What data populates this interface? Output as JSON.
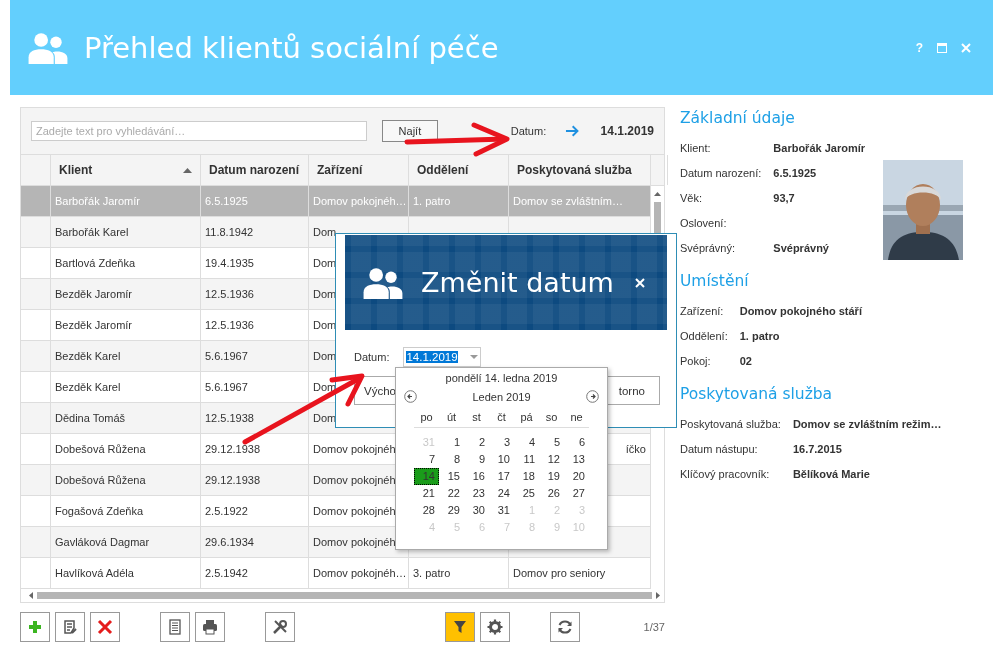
{
  "window": {
    "title": "Přehled klientů sociální péče",
    "help": "?"
  },
  "search": {
    "placeholder": "Zadejte text pro vyhledávání…",
    "button": "Najít",
    "date_label": "Datum:",
    "date_value": "14.1.2019"
  },
  "table": {
    "columns": [
      {
        "label": "Klient",
        "sorted_ascending": true
      },
      {
        "label": "Datum narození"
      },
      {
        "label": "Zařízení"
      },
      {
        "label": "Oddělení"
      },
      {
        "label": "Poskytovaná služba"
      }
    ],
    "rows": [
      {
        "client": "Barbořák Jaromír",
        "birth_date": "6.5.1925",
        "facility": "Domov pokojnéh…",
        "department": "1. patro",
        "service": "Domov se zvláštním…",
        "selected": true
      },
      {
        "client": "Barbořák Karel",
        "birth_date": "11.8.1942",
        "facility": "Dom",
        "selected": false
      },
      {
        "client": "Bartlová Zdeňka",
        "birth_date": "19.4.1935",
        "facility": "Dom",
        "selected": false
      },
      {
        "client": "Bezděk Jaromír",
        "birth_date": "12.5.1936",
        "facility": "Dom",
        "selected": false
      },
      {
        "client": "Bezděk Jaromír",
        "birth_date": "12.5.1936",
        "facility": "Dom",
        "selected": false
      },
      {
        "client": "Bezděk Karel",
        "birth_date": "5.6.1967",
        "facility": "Dom",
        "selected": false
      },
      {
        "client": "Bezděk Karel",
        "birth_date": "5.6.1967",
        "facility": "Dom",
        "selected": false
      },
      {
        "client": "Dědina Tomáš",
        "birth_date": "12.5.1938",
        "facility": "Dom",
        "selected": false
      },
      {
        "client": "Dobešová Růžena",
        "birth_date": "29.12.1938",
        "facility": "Domov pokojnéh",
        "service": "íčko",
        "service_cut_left": true,
        "selected": false
      },
      {
        "client": "Dobešová Růžena",
        "birth_date": "29.12.1938",
        "facility": "Domov pokojnéh",
        "selected": false
      },
      {
        "client": "Fogašová Zdeňka",
        "birth_date": "2.5.1922",
        "facility": "Domov pokojnéh",
        "selected": false
      },
      {
        "client": "Gavláková Dagmar",
        "birth_date": "29.6.1934",
        "facility": "Domov pokojnéh",
        "selected": false
      },
      {
        "client": "Havlíková Adéla",
        "birth_date": "2.5.1942",
        "facility": "Domov pokojnéh…",
        "department": "3. patro",
        "service": "Domov pro seniory",
        "selected": false
      }
    ]
  },
  "toolbar": {
    "left": [
      [
        {
          "kind": "add",
          "on": false
        },
        {
          "kind": "edit",
          "on": false
        },
        {
          "kind": "delete",
          "on": false
        }
      ],
      [
        {
          "kind": "document",
          "on": false
        },
        {
          "kind": "print",
          "on": false
        }
      ],
      [
        {
          "kind": "tools",
          "on": false
        }
      ]
    ],
    "right": [
      [
        {
          "kind": "filter",
          "on": true
        },
        {
          "kind": "settings",
          "on": false
        }
      ],
      [
        {
          "kind": "refresh",
          "on": false
        }
      ]
    ],
    "counter": "1/37"
  },
  "detail": {
    "sections": [
      {
        "title": "Základní údaje",
        "photo": {
          "kind": "picture"
        },
        "fields": [
          {
            "label": "Klient:",
            "value": "Barbořák Jaromír"
          },
          {
            "label": "Datum narození:",
            "value": "6.5.1925"
          },
          {
            "label": "Věk:",
            "value": "93,7"
          },
          {
            "label": "Oslovení:"
          },
          {
            "label": "Svéprávný:",
            "value": "Svéprávný"
          }
        ]
      },
      {
        "title": "Umístění",
        "fields": [
          {
            "label": "Zařízení:",
            "value": "Domov pokojného stáří"
          },
          {
            "label": "Oddělení:",
            "value": "1. patro"
          },
          {
            "label": "Pokoj:",
            "value": "02"
          }
        ]
      },
      {
        "title": "Poskytovaná služba",
        "fields": [
          {
            "label": "Poskytovaná služba:",
            "value": "Domov se zvláštním režim…"
          },
          {
            "label": "Datum nástupu:",
            "value": "16.7.2015"
          },
          {
            "label": "Klíčový pracovník:",
            "value": "Bělíková Marie"
          }
        ]
      }
    ]
  },
  "dialog": {
    "title": "Změnit datum",
    "date_label": "Datum:",
    "date_value": "14.1.2019",
    "value_selected": true,
    "buttons": [
      "Výcho",
      "torno"
    ]
  },
  "calendar": {
    "heading": "pondělí 14. ledna 2019",
    "month": "Leden 2019",
    "weekdays": [
      "po",
      "út",
      "st",
      "čt",
      "pá",
      "so",
      "ne"
    ],
    "weeks": [
      [
        {
          "day": "31",
          "other_month": true,
          "selected": false
        },
        {
          "day": "1",
          "other_month": false,
          "selected": false
        },
        {
          "day": "2",
          "other_month": false,
          "selected": false
        },
        {
          "day": "3",
          "other_month": false,
          "selected": false
        },
        {
          "day": "4",
          "other_month": false,
          "selected": false
        },
        {
          "day": "5",
          "other_month": false,
          "selected": false
        },
        {
          "day": "6",
          "other_month": false,
          "selected": false
        }
      ],
      [
        {
          "day": "7",
          "other_month": false,
          "selected": false
        },
        {
          "day": "8",
          "other_month": false,
          "selected": false
        },
        {
          "day": "9",
          "other_month": false,
          "selected": false
        },
        {
          "day": "10",
          "other_month": false,
          "selected": false
        },
        {
          "day": "11",
          "other_month": false,
          "selected": false
        },
        {
          "day": "12",
          "other_month": false,
          "selected": false
        },
        {
          "day": "13",
          "other_month": false,
          "selected": false
        }
      ],
      [
        {
          "day": "14",
          "other_month": false,
          "selected": true
        },
        {
          "day": "15",
          "other_month": false,
          "selected": false
        },
        {
          "day": "16",
          "other_month": false,
          "selected": false
        },
        {
          "day": "17",
          "other_month": false,
          "selected": false
        },
        {
          "day": "18",
          "other_month": false,
          "selected": false
        },
        {
          "day": "19",
          "other_month": false,
          "selected": false
        },
        {
          "day": "20",
          "other_month": false,
          "selected": false
        }
      ],
      [
        {
          "day": "21",
          "other_month": false,
          "selected": false
        },
        {
          "day": "22",
          "other_month": false,
          "selected": false
        },
        {
          "day": "23",
          "other_month": false,
          "selected": false
        },
        {
          "day": "24",
          "other_month": false,
          "selected": false
        },
        {
          "day": "25",
          "other_month": false,
          "selected": false
        },
        {
          "day": "26",
          "other_month": false,
          "selected": false
        },
        {
          "day": "27",
          "other_month": false,
          "selected": false
        }
      ],
      [
        {
          "day": "28",
          "other_month": false,
          "selected": false
        },
        {
          "day": "29",
          "other_month": false,
          "selected": false
        },
        {
          "day": "30",
          "other_month": false,
          "selected": false
        },
        {
          "day": "31",
          "other_month": false,
          "selected": false
        },
        {
          "day": "1",
          "other_month": true,
          "selected": false
        },
        {
          "day": "2",
          "other_month": true,
          "selected": false
        },
        {
          "day": "3",
          "other_month": true,
          "selected": false
        }
      ],
      [
        {
          "day": "4",
          "other_month": true,
          "selected": false
        },
        {
          "day": "5",
          "other_month": true,
          "selected": false
        },
        {
          "day": "6",
          "other_month": true,
          "selected": false
        },
        {
          "day": "7",
          "other_month": true,
          "selected": false
        },
        {
          "day": "8",
          "other_month": true,
          "selected": false
        },
        {
          "day": "9",
          "other_month": true,
          "selected": false
        },
        {
          "day": "10",
          "other_month": true,
          "selected": false
        }
      ]
    ]
  }
}
